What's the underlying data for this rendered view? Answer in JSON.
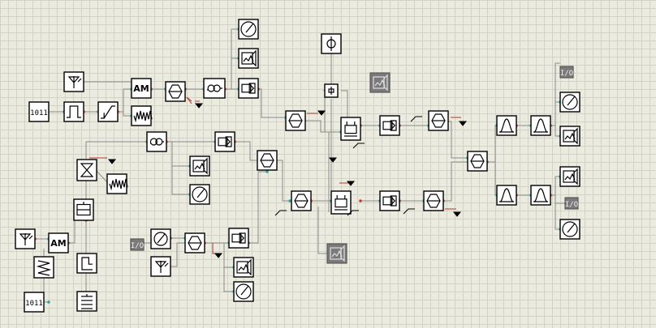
{
  "text": {
    "am_label": "AM",
    "bits_label": "1011",
    "io_label": "I/O"
  },
  "colors": {
    "background": "#ecebe0",
    "grid": "#d3d2c6",
    "block_border": "#000000",
    "wire": "#8a8a8a",
    "wire_active": "#b23a2a",
    "port_in": "#2aa6a0",
    "port_out": "#c23a2a",
    "disabled_block": "#7a7a7a"
  }
}
